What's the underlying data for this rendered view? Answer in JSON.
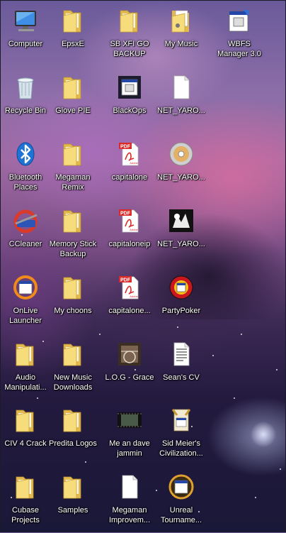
{
  "desktop": {
    "icons": [
      {
        "label": "Computer",
        "type": "computer"
      },
      {
        "label": "EpsxE",
        "type": "folder"
      },
      {
        "label": "SB XFI GO BACKUP",
        "type": "folder"
      },
      {
        "label": "My Music",
        "type": "doc-folder"
      },
      {
        "label": "WBFS Manager 3.0",
        "type": "app"
      },
      {
        "label": "Recycle Bin",
        "type": "recycle"
      },
      {
        "label": "Glove PIE",
        "type": "folder"
      },
      {
        "label": "BlackOps",
        "type": "app-dark"
      },
      {
        "label": "NET_YARO...",
        "type": "blank-doc"
      },
      {
        "label": "Bluetooth Places",
        "type": "bluetooth"
      },
      {
        "label": "Megaman Remix",
        "type": "folder"
      },
      {
        "label": "capitalone",
        "type": "pdf"
      },
      {
        "label": "NET_YARO...",
        "type": "disc"
      },
      {
        "label": "CCleaner",
        "type": "ccleaner"
      },
      {
        "label": "Memory Stick Backup",
        "type": "folder"
      },
      {
        "label": "capitaloneip",
        "type": "pdf"
      },
      {
        "label": "NET_YARO...",
        "type": "game-art"
      },
      {
        "label": "OnLive Launcher",
        "type": "onlive"
      },
      {
        "label": "My choons",
        "type": "folder"
      },
      {
        "label": "capitalone...",
        "type": "pdf"
      },
      {
        "label": "PartyPoker",
        "type": "partypoker"
      },
      {
        "label": "Audio Manipulati...",
        "type": "folder"
      },
      {
        "label": "New Music Downloads",
        "type": "folder"
      },
      {
        "label": "L.O.G - Grace",
        "type": "music"
      },
      {
        "label": "Sean's CV",
        "type": "text-doc"
      },
      {
        "label": "CIV 4 Crack",
        "type": "folder"
      },
      {
        "label": "Predita Logos",
        "type": "folder"
      },
      {
        "label": "Me an dave jammin",
        "type": "video"
      },
      {
        "label": "Sid Meier's Civilization...",
        "type": "civ"
      },
      {
        "label": "Cubase Projects",
        "type": "folder"
      },
      {
        "label": "Samples",
        "type": "folder"
      },
      {
        "label": "Megaman Improvem...",
        "type": "blank-doc"
      },
      {
        "label": "Unreal Tourname...",
        "type": "app-ring"
      }
    ]
  },
  "icon_names": {
    "computer": "computer-icon",
    "folder": "folder-icon",
    "doc-folder": "music-folder-icon",
    "app": "application-icon",
    "app-dark": "application-icon",
    "recycle": "recycle-bin-icon",
    "blank-doc": "document-icon",
    "bluetooth": "bluetooth-icon",
    "pdf": "pdf-icon",
    "disc": "disc-image-icon",
    "ccleaner": "ccleaner-icon",
    "game-art": "game-art-icon",
    "onlive": "onlive-icon",
    "partypoker": "partypoker-icon",
    "music": "music-file-icon",
    "text-doc": "text-document-icon",
    "video": "video-file-icon",
    "civ": "civilization-icon",
    "app-ring": "application-icon"
  },
  "colors": {
    "folder_front": "#f7dc7b",
    "folder_back": "#e3b94e",
    "pdf_red": "#d92b2b",
    "label_text": "#ffffff"
  }
}
